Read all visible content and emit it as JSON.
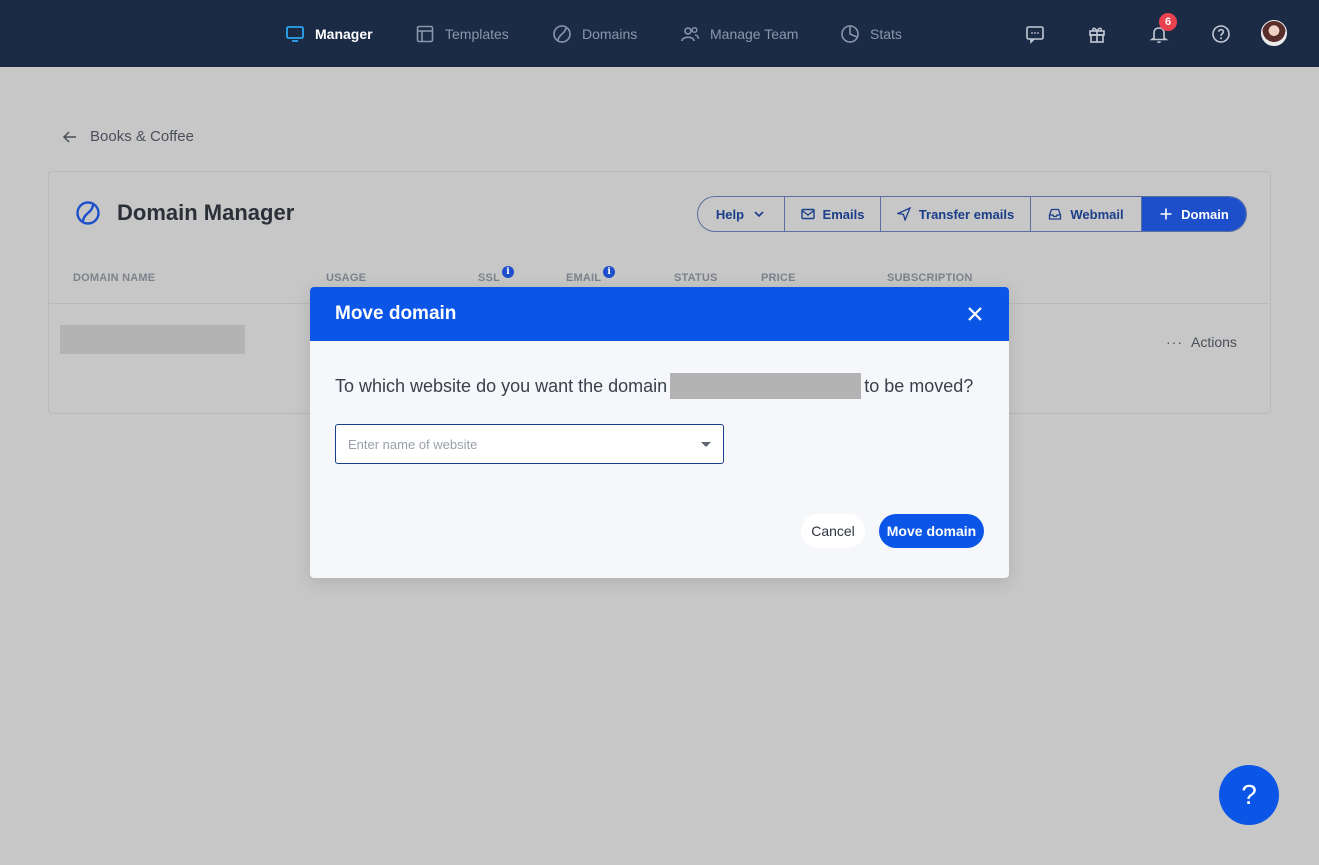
{
  "nav": {
    "items": [
      {
        "label": "Manager",
        "icon": "monitor-icon"
      },
      {
        "label": "Templates",
        "icon": "template-icon"
      },
      {
        "label": "Domains",
        "icon": "globe-icon"
      },
      {
        "label": "Manage Team",
        "icon": "team-icon"
      },
      {
        "label": "Stats",
        "icon": "pie-chart-icon"
      }
    ],
    "notifications_count": "6"
  },
  "page": {
    "back_label": "Books & Coffee",
    "title": "Domain Manager",
    "buttons": {
      "help": "Help",
      "emails": "Emails",
      "transfer_emails": "Transfer emails",
      "webmail": "Webmail",
      "add_domain": "Domain"
    },
    "columns": [
      "DOMAIN NAME",
      "USAGE",
      "SSL",
      "EMAIL",
      "STATUS",
      "PRICE",
      "SUBSCRIPTION"
    ],
    "info_glyph": "i",
    "row_actions": "Actions"
  },
  "modal": {
    "title": "Move domain",
    "question_before": "To which website do you want the domain",
    "question_after": "to be moved?",
    "select_placeholder": "Enter name of website",
    "cancel": "Cancel",
    "confirm": "Move domain"
  },
  "help_fab": "?",
  "colors": {
    "topbar": "#1b2b45",
    "accent": "#0b56e6",
    "badge": "#e8434f",
    "overlay_bg": "#c7c7c7"
  }
}
